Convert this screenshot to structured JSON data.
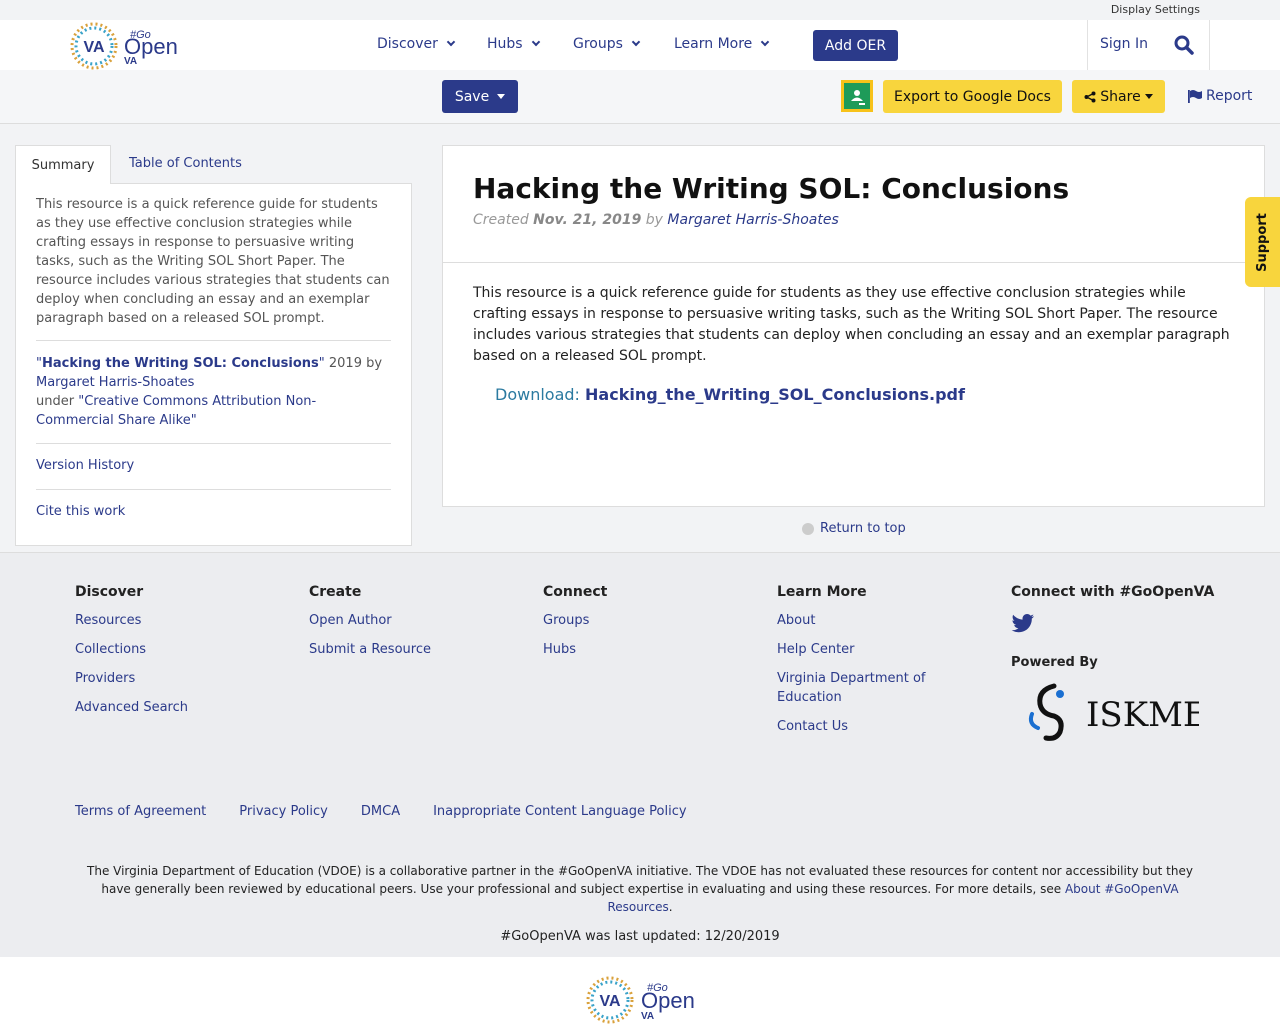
{
  "header": {
    "display_settings": "Display Settings",
    "logo": {
      "va": "VA",
      "go": "#Go",
      "open": "Open",
      "va2": "VA"
    },
    "nav": [
      {
        "label": "Discover"
      },
      {
        "label": "Hubs"
      },
      {
        "label": "Groups"
      },
      {
        "label": "Learn More"
      }
    ],
    "add_oer": "Add OER",
    "sign_in": "Sign In"
  },
  "toolbar": {
    "save": "Save",
    "export": "Export to Google Docs",
    "share": "Share",
    "report": "Report"
  },
  "sidebar": {
    "tabs": [
      "Summary",
      "Table of Contents"
    ],
    "summary": "This resource is a quick reference guide for students as they use effective conclusion strategies while crafting essays in response to persuasive writing tasks, such as the Writing SOL Short Paper. The resource includes various strategies that students can deploy when concluding an essay and an exemplar paragraph based on a released SOL prompt.",
    "attribution": {
      "title": "Hacking the Writing SOL: Conclusions",
      "year": "2019 by",
      "author": "Margaret Harris-Shoates",
      "under": "under",
      "license": "Creative Commons Attribution Non-Commercial Share Alike"
    },
    "version_history": "Version History",
    "cite": "Cite this work"
  },
  "main": {
    "title": "Hacking the Writing SOL: Conclusions",
    "created_label": "Created",
    "created_date": "Nov. 21, 2019",
    "by": "by",
    "author": "Margaret Harris-Shoates",
    "description": "This resource is a quick reference guide for students as they use effective conclusion strategies while crafting essays in response to persuasive writing tasks, such as the Writing SOL Short Paper. The resource includes various strategies that students can deploy when concluding an essay and an exemplar paragraph based on a released SOL prompt.",
    "download_label": "Download:",
    "download_file": "Hacking_the_Writing_SOL_Conclusions.pdf",
    "return_to_top": "Return to top"
  },
  "support": "Support",
  "footer": {
    "columns": [
      {
        "heading": "Discover",
        "links": [
          "Resources",
          "Collections",
          "Providers",
          "Advanced Search"
        ]
      },
      {
        "heading": "Create",
        "links": [
          "Open Author",
          "Submit a Resource"
        ]
      },
      {
        "heading": "Connect",
        "links": [
          "Groups",
          "Hubs"
        ]
      },
      {
        "heading": "Learn More",
        "links": [
          "About",
          "Help Center",
          "Virginia Department of Education",
          "Contact Us"
        ]
      }
    ],
    "connect_heading": "Connect with #GoOpenVA",
    "powered_by": "Powered By",
    "iskme": "ISKME",
    "legal": [
      "Terms of Agreement",
      "Privacy Policy",
      "DMCA",
      "Inappropriate Content Language Policy"
    ],
    "vdoe_text": "The Virginia Department of Education (VDOE) is a collaborative partner in the #GoOpenVA initiative. The VDOE has not evaluated these resources for content nor accessibility but they have generally been reviewed by educational peers. Use your professional and subject expertise in evaluating and using these resources. For more details, see",
    "vdoe_link": "About #GoOpenVA Resources",
    "vdoe_end": ".",
    "updated": "#GoOpenVA was last updated: 12/20/2019"
  },
  "colors": {
    "brand": "#2b3a8a",
    "accent_yellow": "#f8d53d"
  }
}
